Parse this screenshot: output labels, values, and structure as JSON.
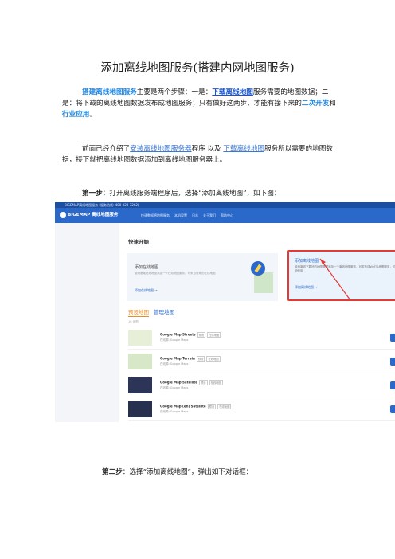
{
  "doc": {
    "title": "添加离线地图服务(搭建内网地图服务)",
    "p1": {
      "lead": "搭建离线地图服务",
      "t1": "主要是两个步骤：一是：",
      "link": "下载离线地图",
      "t2": "服务需要的地图数据；二是：将下载的离线地图数据发布成地图服务；只有做好这两步，才能有接下来的",
      "kw1": "二次开发",
      "and": "和",
      "kw2": "行业应用",
      "end": "。"
    },
    "p2": {
      "t1": "前面已经介绍了",
      "link1": "安装离线地图服务器",
      "t2": "程序 以及 ",
      "link2": "下载离线地图",
      "t3": "服务所以需要的地图数据，接下就把离线地图数据添加到离线地图服务器上。"
    },
    "step1": {
      "label": "第一步",
      "text": "：打开离线服务端程序后，选择“添加离线地图”，如下图："
    },
    "step2": {
      "label": "第二步",
      "text": "：选择“添加离线地图”，弹出如下对话框："
    }
  },
  "screenshot": {
    "titlebar": "BIGEMAP离线地图服务 (服务热线: 400-028-7262)",
    "app_name": "离线地图服务",
    "brand": "BIGEMAP",
    "nav": [
      "快速数据将地图服务",
      "本机设置",
      "日志",
      "关于我们",
      "帮助中心"
    ],
    "quick_start": "快速开始",
    "card_online": {
      "title": "添加在线地图",
      "desc": "使用基础在线地图添加一个在线地图服务，可来自常规的在线地图",
      "action": "添加在线地图 →"
    },
    "card_offline": {
      "title": "添加离线地图",
      "desc": "使用离线下载好的地图数据添加一个离线地图服务，可发布成WMTS地图服务，可供内网使用",
      "action": "添加离线地图 →"
    },
    "tabs": [
      "预设地图",
      "管理地图"
    ],
    "count": "16 地图",
    "maps": [
      {
        "name": "Google Map Streets",
        "tags": [
          "预设",
          "在线地图"
        ],
        "source": "在线源: Google Maps"
      },
      {
        "name": "Google Map Terrain",
        "tags": [
          "预设",
          "在线地图"
        ],
        "source": "在线源: Google Maps"
      },
      {
        "name": "Google Map Satellite",
        "tags": [
          "预设",
          "在线地图"
        ],
        "source": "在线源: Google Maps"
      },
      {
        "name": "Google Map (en) Satellite",
        "tags": [
          "预设",
          "在线地图"
        ],
        "source": "在线源: Google Maps"
      }
    ],
    "colors": {
      "appbar": "#2a68c9",
      "highlight": "#e53935",
      "tab_active": "#f08c1a"
    }
  }
}
